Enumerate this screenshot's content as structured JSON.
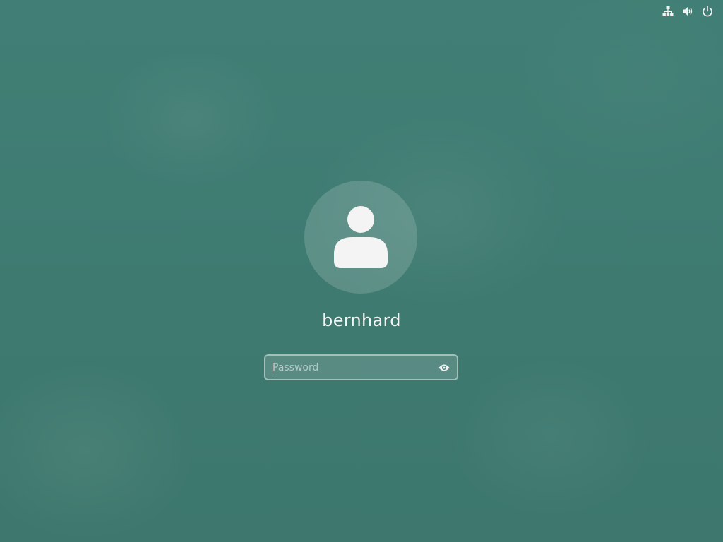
{
  "top_bar": {
    "icons": [
      "network-wired-icon",
      "volume-icon",
      "power-icon"
    ]
  },
  "login": {
    "username": "bernhard",
    "avatar_icon": "user-avatar-icon",
    "password": {
      "value": "",
      "placeholder": "Password",
      "reveal_icon": "eye-icon"
    }
  },
  "colors": {
    "background": "#3e7b71",
    "text": "#f3f5f4",
    "icon": "#f2f2f2"
  }
}
